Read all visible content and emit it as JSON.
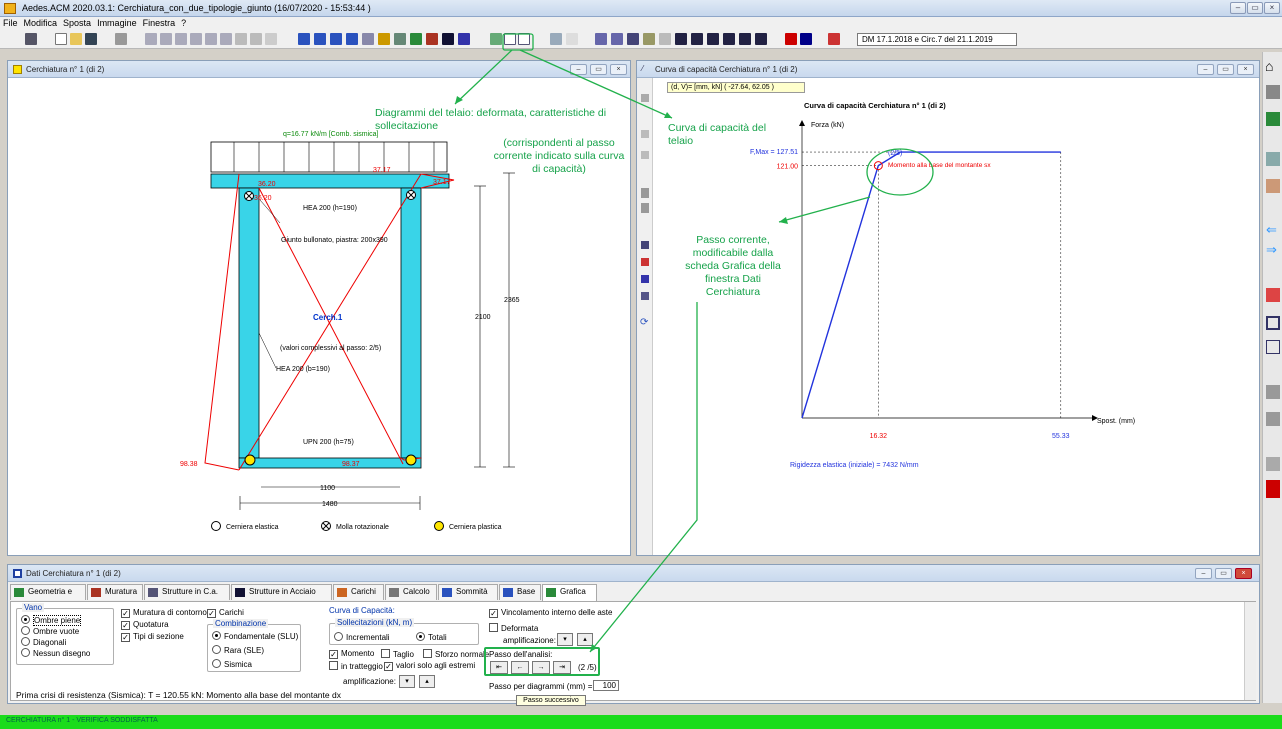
{
  "app": {
    "title": "Aedes.ACM 2020.03.1: Cerchiatura_con_due_tipologie_giunto  (16/07/2020 - 15:53:44 )",
    "menu": [
      "File",
      "Modifica",
      "Sposta",
      "Immagine",
      "Finestra",
      "?"
    ],
    "norm_label": "DM 17.1.2018 e Circ.7 del 21.1.2019",
    "status_text": "CERCHIATURA n° 1 - VERIFICA SODDISFATTA"
  },
  "win_frame": {
    "title": "Cerchiatura n° 1 (di 2)",
    "load_label": "q=16.77 kN/m [Comb. sismica]",
    "beam_label": "HEA 200 (h=190)",
    "joint_label": "Giunto bullonato, piastra: 200x390",
    "frame_name": "Cerch.1",
    "step_note": "(valori complessivi al passo: 2/5)",
    "column_label": "HEA 200 (b=190)",
    "base_label": "UPN 200 (h=75)",
    "m_top_left": "36.20",
    "m_top_left2": "36.20",
    "m_top_right": "37.17",
    "m_top_right2": "37.17",
    "m_bot_left": "98.38",
    "m_bot_right": "98.37",
    "dim_inner_h": "2100",
    "dim_outer_h": "2365",
    "dim_inner_w": "1100",
    "dim_outer_w": "1480",
    "legend": [
      "Cerniera elastica",
      "Molla rotazionale",
      "Cerniera plastica"
    ]
  },
  "win_curve": {
    "title": "Curva di capacità Cerchiatura n° 1 (di 2)",
    "coord_readout": "(d, V)= [mm, kN]  ( -27.64, 62.05 )",
    "chart_title": "Curva di capacità Cerchiatura n° 1 (di 2)",
    "y_axis_label": "Forza (kN)",
    "x_axis_label": "Spost. (mm)",
    "fmax_label": "F,Max = 127.51",
    "y_mark": "121.00",
    "x_mark_1": "16.32",
    "x_mark_2": "55.33",
    "step_label": "(2/5)",
    "step_desc": "Momento alla base del montante sx",
    "stiffness": "Rigidezza elastica (iniziale) = 7432 N/mm"
  },
  "chart_data": {
    "type": "line",
    "title": "Curva di capacità Cerchiatura n° 1 (di 2)",
    "xlabel": "Spost. (mm)",
    "ylabel": "Forza (kN)",
    "series": [
      {
        "name": "",
        "x": [
          0,
          16.32,
          21.0,
          55.33
        ],
        "y": [
          0,
          121.0,
          127.51,
          127.51
        ]
      }
    ],
    "x_ticks": [
      16.32,
      55.33
    ],
    "y_ticks": [
      121.0,
      127.51
    ],
    "xlim": [
      0,
      62
    ],
    "ylim": [
      0,
      140
    ]
  },
  "annotations": {
    "diagrams": "Diagrammi del telaio: deformata, caratteristiche di sollecitazione",
    "diagrams_note": "(corrispondenti al passo corrente indicato sulla curva di capacità)",
    "curve": "Curva di capacità del telaio",
    "step": "Passo corrente, modificabile dalla scheda Grafica della finestra Dati Cerchiatura"
  },
  "dati": {
    "title": "Dati Cerchiatura n° 1 (di 2)",
    "tabs": [
      "Geometria e Vincoli",
      "Muratura",
      "Strutture in C.a.",
      "Strutture in Acciaio",
      "Carichi",
      "Calcolo",
      "Sommità",
      "Base",
      "Grafica"
    ],
    "vano_title": "Vano",
    "vano_options": [
      "Ombre piene",
      "Ombre vuote",
      "Diagonali",
      "Nessun disegno"
    ],
    "checks_col1": [
      "Muratura di contorno",
      "Quotatura",
      "Tipi di sezione"
    ],
    "check_carichi": "Carichi",
    "comb_title": "Combinazione",
    "comb_options": [
      "Fondamentale (SLU)",
      "Rara (SLE)",
      "Sismica"
    ],
    "curva_title": "Curva di Capacità:",
    "soll_title": "Sollecitazioni (kN, m)",
    "soll_options": [
      "Incrementali",
      "Totali"
    ],
    "diag_checks": [
      "Momento",
      "Taglio",
      "Sforzo normale"
    ],
    "tratteggio": "in tratteggio",
    "estremi": "valori solo agli estremi",
    "amplif": "amplificazione:",
    "vincolamento": "Vincolamento interno delle aste",
    "deformata": "Deformata",
    "amplif2": "amplificazione:",
    "passo_title": "Passo dell'analisi:",
    "passo_value": "(2 /5)",
    "passo_diag": "Passo per diagrammi (mm) =",
    "passo_diag_val": "100",
    "tooltip": "Passo successivo",
    "crisis": "Prima crisi di resistenza (Sismica): T = 120.55 kN: Momento alla base del montante dx"
  }
}
